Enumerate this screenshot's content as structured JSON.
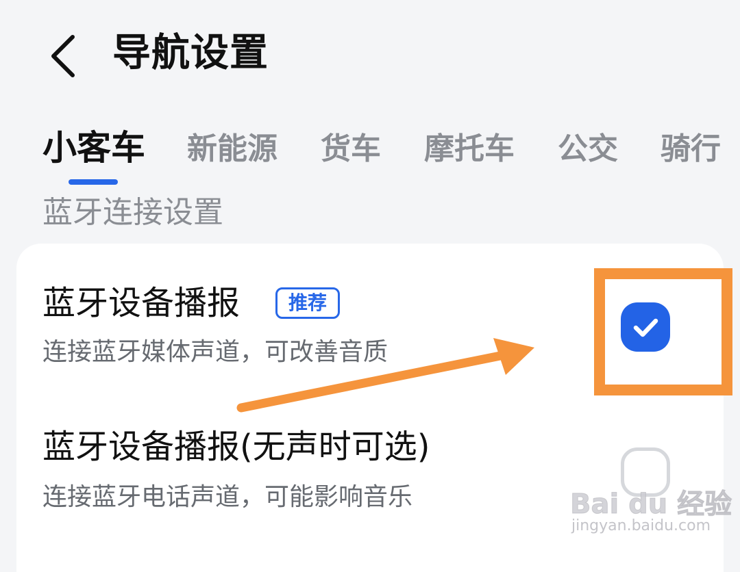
{
  "header": {
    "back_icon": "chevron-left-icon",
    "title": "导航设置"
  },
  "tabs": [
    {
      "label": "小客车",
      "active": true
    },
    {
      "label": "新能源",
      "active": false
    },
    {
      "label": "货车",
      "active": false
    },
    {
      "label": "摩托车",
      "active": false
    },
    {
      "label": "公交",
      "active": false
    },
    {
      "label": "骑行",
      "active": false
    }
  ],
  "section": {
    "label": "蓝牙连接设置"
  },
  "settings": [
    {
      "title": "蓝牙设备播报",
      "badge": "推荐",
      "subtitle": "连接蓝牙媒体声道，可改善音质",
      "checked": true
    },
    {
      "title": "蓝牙设备播报(无声时可选)",
      "subtitle": "连接蓝牙电话声道，可能影响音乐",
      "checked": false
    }
  ],
  "watermark": {
    "logo": "Bai du 经验",
    "url": "jingyan.baidu.com"
  },
  "colors": {
    "accent": "#2767e8",
    "annotation": "#f5943c",
    "background": "#f4f5f7"
  }
}
